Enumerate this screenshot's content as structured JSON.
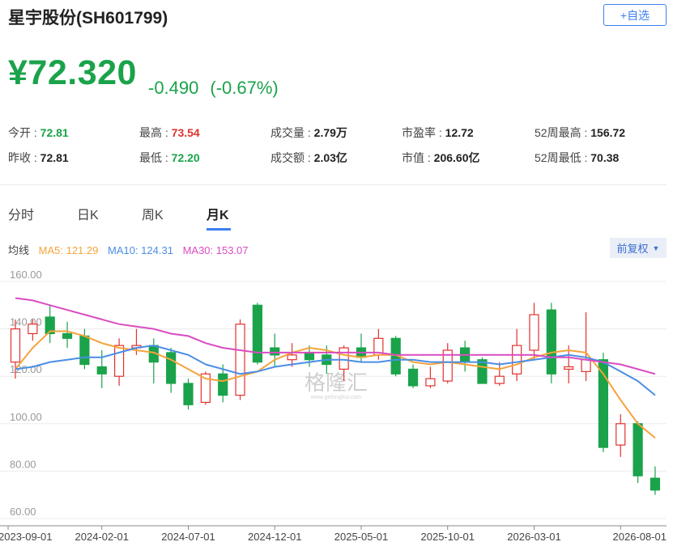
{
  "header": {
    "title": "星宇股份(SH601799)",
    "watch_label": "+自选"
  },
  "quote": {
    "price": "¥72.320",
    "change": "-0.490",
    "change_pct": "(-0.67%)"
  },
  "stats": {
    "open_label": "今开 : ",
    "open": "72.81",
    "high_label": "最高 : ",
    "high": "73.54",
    "volume_label": "成交量 : ",
    "volume": "2.79万",
    "pe_label": "市盈率 : ",
    "pe": "12.72",
    "wk52_high_label": "52周最高 : ",
    "wk52_high": "156.72",
    "prev_close_label": "昨收 : ",
    "prev_close": "72.81",
    "low_label": "最低 : ",
    "low": "72.20",
    "turnover_label": "成交额 : ",
    "turnover": "2.03亿",
    "mcap_label": "市值 : ",
    "mcap": "206.60亿",
    "wk52_low_label": "52周最低 : ",
    "wk52_low": "70.38"
  },
  "tabs": [
    "分时",
    "日K",
    "周K",
    "月K"
  ],
  "ma": {
    "label": "均线",
    "ma5": "MA5: 121.29",
    "ma10": "MA10: 124.31",
    "ma30": "MA30: 153.07"
  },
  "adjust_label": "前复权",
  "colors": {
    "up": "#e0322f",
    "down": "#1aa34a",
    "ma5": "#f5a33b",
    "ma10": "#4a8ee6",
    "ma30": "#d94cc1",
    "accent": "#3b7ff2"
  },
  "chart_data": {
    "type": "candlestick",
    "ylim": [
      60,
      160
    ],
    "y_ticks": [
      "160.00",
      "140.00",
      "120.00",
      "100.00",
      "80.00",
      "60.00"
    ],
    "x_ticks": [
      "2023-09-01",
      "2024-02-01",
      "2024-07-01",
      "2024-12-01",
      "2025-05-01",
      "2025-10-01",
      "2026-03-01",
      "2026-08-01"
    ],
    "watermark": "格隆汇",
    "watermark_sub": "www.gelonghui.com",
    "candles": [
      {
        "o": 126,
        "c": 140,
        "h": 144,
        "l": 119
      },
      {
        "o": 138,
        "c": 142,
        "h": 144,
        "l": 135
      },
      {
        "o": 145,
        "c": 138,
        "h": 150,
        "l": 134
      },
      {
        "o": 138,
        "c": 136,
        "h": 143,
        "l": 132
      },
      {
        "o": 137,
        "c": 125,
        "h": 140,
        "l": 123
      },
      {
        "o": 124,
        "c": 121,
        "h": 131,
        "l": 115
      },
      {
        "o": 120,
        "c": 133,
        "h": 136,
        "l": 116
      },
      {
        "o": 132,
        "c": 133,
        "h": 140,
        "l": 129
      },
      {
        "o": 133,
        "c": 126,
        "h": 136,
        "l": 117
      },
      {
        "o": 130,
        "c": 117,
        "h": 132,
        "l": 113
      },
      {
        "o": 117,
        "c": 108,
        "h": 119,
        "l": 106
      },
      {
        "o": 109,
        "c": 121,
        "h": 122,
        "l": 108
      },
      {
        "o": 121,
        "c": 112,
        "h": 125,
        "l": 109
      },
      {
        "o": 112,
        "c": 142,
        "h": 144,
        "l": 110
      },
      {
        "o": 150,
        "c": 126,
        "h": 151,
        "l": 125
      },
      {
        "o": 132,
        "c": 129,
        "h": 138,
        "l": 124
      },
      {
        "o": 127,
        "c": 129,
        "h": 134,
        "l": 124
      },
      {
        "o": 130,
        "c": 127,
        "h": 133,
        "l": 124
      },
      {
        "o": 129,
        "c": 125,
        "h": 133,
        "l": 121
      },
      {
        "o": 123,
        "c": 132,
        "h": 133,
        "l": 118
      },
      {
        "o": 132,
        "c": 128,
        "h": 138,
        "l": 126
      },
      {
        "o": 129,
        "c": 136,
        "h": 140,
        "l": 127
      },
      {
        "o": 136,
        "c": 121,
        "h": 137,
        "l": 120
      },
      {
        "o": 123,
        "c": 116,
        "h": 125,
        "l": 115
      },
      {
        "o": 116,
        "c": 119,
        "h": 124,
        "l": 115
      },
      {
        "o": 118,
        "c": 131,
        "h": 134,
        "l": 117
      },
      {
        "o": 132,
        "c": 126,
        "h": 135,
        "l": 122
      },
      {
        "o": 127,
        "c": 117,
        "h": 128,
        "l": 117
      },
      {
        "o": 117,
        "c": 120,
        "h": 126,
        "l": 116
      },
      {
        "o": 121,
        "c": 133,
        "h": 140,
        "l": 118
      },
      {
        "o": 131,
        "c": 146,
        "h": 151,
        "l": 127
      },
      {
        "o": 148,
        "c": 121,
        "h": 151,
        "l": 117
      },
      {
        "o": 123,
        "c": 124,
        "h": 133,
        "l": 117
      },
      {
        "o": 122,
        "c": 127,
        "h": 147,
        "l": 118
      },
      {
        "o": 127,
        "c": 90,
        "h": 130,
        "l": 88
      },
      {
        "o": 91,
        "c": 100,
        "h": 104,
        "l": 86
      },
      {
        "o": 100,
        "c": 78,
        "h": 101,
        "l": 75
      },
      {
        "o": 77,
        "c": 72,
        "h": 82,
        "l": 70
      }
    ],
    "series": [
      {
        "name": "MA5",
        "values": [
          123,
          132,
          139,
          139,
          137,
          134,
          132,
          131,
          130,
          127,
          123,
          119,
          118,
          120,
          122,
          127,
          130,
          132,
          131,
          129,
          128,
          129,
          129,
          126,
          125,
          126,
          125,
          124,
          123,
          125,
          128,
          130,
          131,
          130,
          121,
          110,
          100,
          94
        ]
      },
      {
        "name": "MA10",
        "values": [
          123,
          124,
          126,
          127,
          128,
          128,
          130,
          132,
          133,
          131,
          129,
          125,
          123,
          121,
          122,
          124,
          125,
          126,
          127,
          127,
          126,
          126,
          127,
          127,
          126,
          126,
          126,
          126,
          125,
          126,
          127,
          128,
          129,
          128,
          126,
          122,
          118,
          112
        ]
      },
      {
        "name": "MA30",
        "values": [
          153,
          152,
          150,
          148,
          146,
          144,
          142,
          141,
          140,
          138,
          137,
          134,
          132,
          131,
          130,
          130,
          130,
          130,
          130,
          130,
          130,
          130,
          129,
          129,
          129,
          129,
          129,
          129,
          129,
          129,
          129,
          128,
          128,
          127,
          126,
          125,
          123,
          121
        ]
      }
    ]
  }
}
